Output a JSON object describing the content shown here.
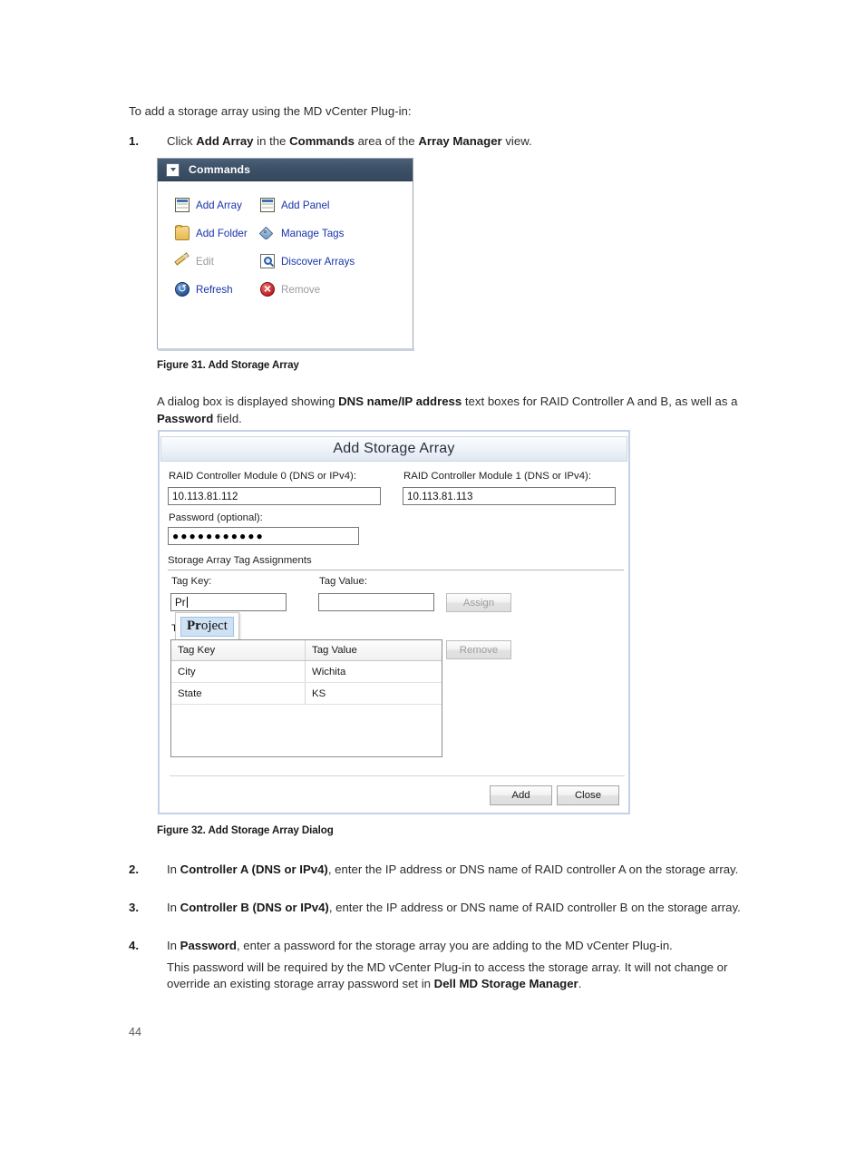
{
  "page": {
    "number": "44"
  },
  "intro": {
    "text": "To add a storage array using the MD vCenter Plug-in:"
  },
  "steps": [
    {
      "num": "1.",
      "prefix": "Click ",
      "b1": "Add Array",
      "mid1": " in the ",
      "b2": "Commands",
      "mid2": " area of the ",
      "b3": "Array Manager",
      "suffix": " view."
    },
    {
      "num": "2.",
      "prefix": "In ",
      "b1": "Controller A (DNS or IPv4)",
      "suffix": ", enter the IP address or DNS name of RAID controller A on the storage array."
    },
    {
      "num": "3.",
      "prefix": "In ",
      "b1": "Controller B (DNS or IPv4)",
      "suffix": ", enter the IP address or DNS name of RAID controller B on the storage array."
    },
    {
      "num": "4.",
      "prefix": "In ",
      "b1": "Password",
      "suffix": ", enter a password for the storage array you are adding to the MD vCenter Plug-in.",
      "sub_prefix": "This password will be required by the MD vCenter Plug-in to access the storage array. It will not change or override an existing storage array password set in ",
      "sub_b": "Dell MD Storage Manager",
      "sub_suffix": "."
    }
  ],
  "paragraph_after_fig31": {
    "prefix": "A dialog box is displayed showing ",
    "b1": "DNS name/IP address",
    "mid": " text boxes for RAID Controller A and B, as well as a ",
    "b2": "Password",
    "suffix": " field."
  },
  "figure31": {
    "caption": "Figure 31. Add Storage Array",
    "panel_title": "Commands",
    "collapse_icon": "chevron-down-icon",
    "commands": [
      {
        "label": "Add Array",
        "icon": "add-array-icon",
        "enabled": true
      },
      {
        "label": "Add Panel",
        "icon": "add-panel-icon",
        "enabled": true
      },
      {
        "label": "Add Folder",
        "icon": "add-folder-icon",
        "enabled": true
      },
      {
        "label": "Manage Tags",
        "icon": "tag-icon",
        "enabled": true
      },
      {
        "label": "Edit",
        "icon": "pencil-icon",
        "enabled": false
      },
      {
        "label": "Discover Arrays",
        "icon": "magnifier-icon",
        "enabled": true
      },
      {
        "label": "Refresh",
        "icon": "refresh-icon",
        "enabled": true
      },
      {
        "label": "Remove",
        "icon": "remove-icon",
        "enabled": false
      }
    ],
    "colors": {
      "header_bg": "#3c5066",
      "link_text": "#1834a8",
      "disabled_text": "#9b9b9b"
    }
  },
  "figure32": {
    "caption": "Figure 32. Add Storage Array Dialog",
    "dialog_title": "Add Storage Array",
    "controller0": {
      "label": "RAID Controller Module 0 (DNS or IPv4):",
      "value": "10.113.81.112"
    },
    "controller1": {
      "label": "RAID Controller Module 1 (DNS or IPv4):",
      "value": "10.113.81.113"
    },
    "password": {
      "label": "Password (optional):",
      "value": "●●●●●●●●●●●"
    },
    "group_label": "Storage Array Tag Assignments",
    "tag_key": {
      "label": "Tag Key:",
      "value": "Pr"
    },
    "tag_value": {
      "label": "Tag Value:",
      "value": ""
    },
    "assign_button": {
      "label": "Assign",
      "enabled": false
    },
    "remove_button": {
      "label": "Remove",
      "enabled": false
    },
    "autocomplete": {
      "typed": "Pr",
      "rest": "oject",
      "full": "Project"
    },
    "obscured_label": "T",
    "table": {
      "headers": [
        "Tag Key",
        "Tag Value"
      ],
      "rows": [
        [
          "City",
          "Wichita"
        ],
        [
          "State",
          "KS"
        ]
      ]
    },
    "footer_buttons": [
      {
        "label": "Add",
        "enabled": true
      },
      {
        "label": "Close",
        "enabled": true
      }
    ],
    "ghost_text": "a bar of faint clipped text from the window behind"
  }
}
